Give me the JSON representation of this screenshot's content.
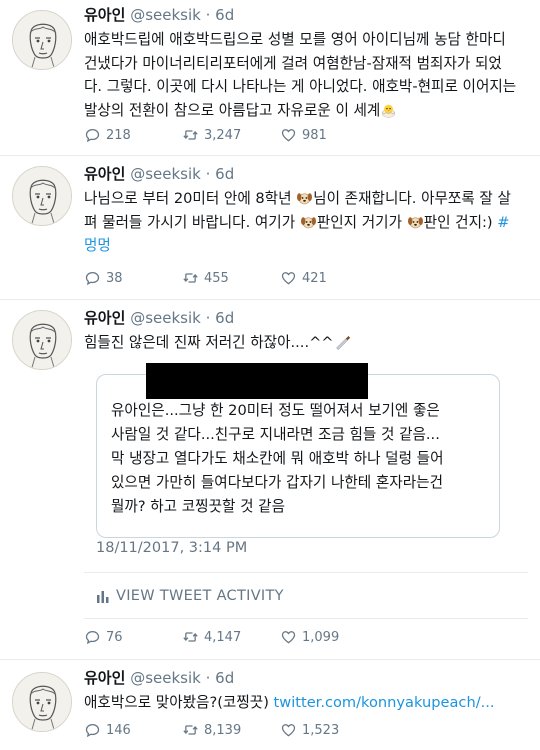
{
  "tweets": [
    {
      "name": "유아인",
      "handle": "@seeksik",
      "dot": "·",
      "time": "6d",
      "lines": [
        "애호박드립에 애호박드립으로 성별 모를 영어 아이디님께 농담 한마디",
        "건냈다가 마이너리티리포터에게 걸려 여혐한남-잠재적 범죄자가 되었",
        "다. 그렇다. 이곳에 다시 나타나는 게 아니었다. 애호박-현피로 이어지는",
        "발상의 전환이 참으로 아름답고 자유로운 이 세계"
      ],
      "reply": "",
      "retweets": "3,247",
      "likes": "981",
      "replies": "218"
    },
    {
      "name": "유아인",
      "handle": "@seeksik",
      "dot": "·",
      "time": "6d",
      "l1a": "나님으로 부터 20미터 안에 8학년 ",
      "l1b": "님이 존재합니다. 아무쪼록 잘 살",
      "l2a": "펴 물러들 가시기 바랍니다. 여기가 ",
      "l2b": "판인지 거기가 ",
      "l2c": "판인 건지:) ",
      "l2d": "#",
      "l3": "멍멍",
      "replies": "38",
      "retweets": "455",
      "likes": "421"
    },
    {
      "name": "유아인",
      "handle": "@seeksik",
      "dot": "·",
      "time": "6d",
      "text": "힘들진 않은데 진짜 저러긴 하잖아....^^",
      "quote_lines": [
        "유아인은...그냥 한 20미터 정도 떨어져서 보기엔 좋은",
        "사람일 것 같다...친구로 지내라면 조금 힘들 것 같음...",
        "막 냉장고 열다가도 채소칸에 뭐 애호박 하나 덜렁 들어",
        "있으면 가만히 들여다보다가 갑자기 나한테 혼자라는건",
        "뭘까? 하고 코찡끗할 것 같음"
      ],
      "timestamp": "18/11/2017, 3:14 PM",
      "activity": "VIEW TWEET ACTIVITY",
      "replies": "76",
      "retweets": "4,147",
      "likes": "1,099"
    },
    {
      "name": "유아인",
      "handle": "@seeksik",
      "dot": "·",
      "time": "6d",
      "text": "애호박으로 맞아봤음?(코찡끗) ",
      "link": "twitter.com/konnyakupeach/...",
      "replies": "146",
      "retweets": "8,139",
      "likes": "1,523"
    }
  ],
  "colors": {
    "link": "#1b95e0",
    "muted": "#657786",
    "border": "#e6ecf0"
  },
  "icons": [
    "avatar-sketch",
    "reply-icon",
    "retweet-icon",
    "heart-icon",
    "chick-emoji",
    "dog-emoji",
    "knife-emoji",
    "bar-chart-icon"
  ]
}
